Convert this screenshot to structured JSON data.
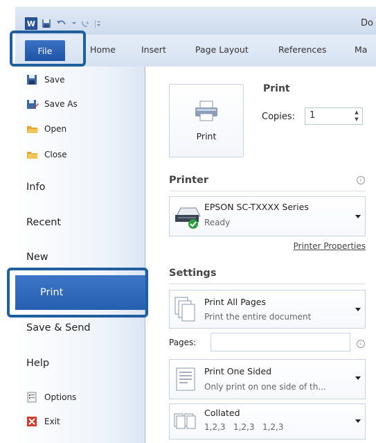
{
  "title_bar": {
    "app_logo": "W",
    "document_title": "Do",
    "quick_access": [
      "save-icon",
      "undo-icon",
      "redo-icon",
      "customize-icon"
    ]
  },
  "ribbon": {
    "tabs": [
      {
        "label": "File"
      },
      {
        "label": "Home"
      },
      {
        "label": "Insert"
      },
      {
        "label": "Page Layout"
      },
      {
        "label": "References"
      },
      {
        "label": "Ma"
      }
    ]
  },
  "backstage_nav": {
    "save": "Save",
    "save_as": "Save As",
    "open": "Open",
    "close": "Close",
    "info": "Info",
    "recent": "Recent",
    "new": "New",
    "print": "Print",
    "save_send": "Save & Send",
    "help": "Help",
    "options": "Options",
    "exit": "Exit"
  },
  "print_panel": {
    "print_button_label": "Print",
    "heading": "Print",
    "copies_label": "Copies:",
    "copies_value": "1",
    "printer_heading": "Printer",
    "printer_name": "EPSON SC-TXXXX Series",
    "printer_status": "Ready",
    "printer_properties": "Printer Properties",
    "settings_heading": "Settings",
    "print_range_title": "Print All Pages",
    "print_range_sub": "Print the entire document",
    "pages_label": "Pages:",
    "pages_value": "",
    "sided_title": "Print One Sided",
    "sided_sub": "Only print on one side of th...",
    "collate_title": "Collated",
    "collate_sub": "1,2,3   1,2,3   1,2,3"
  },
  "colors": {
    "accent": "#275fb0",
    "highlight_border": "#1f5f9e"
  }
}
